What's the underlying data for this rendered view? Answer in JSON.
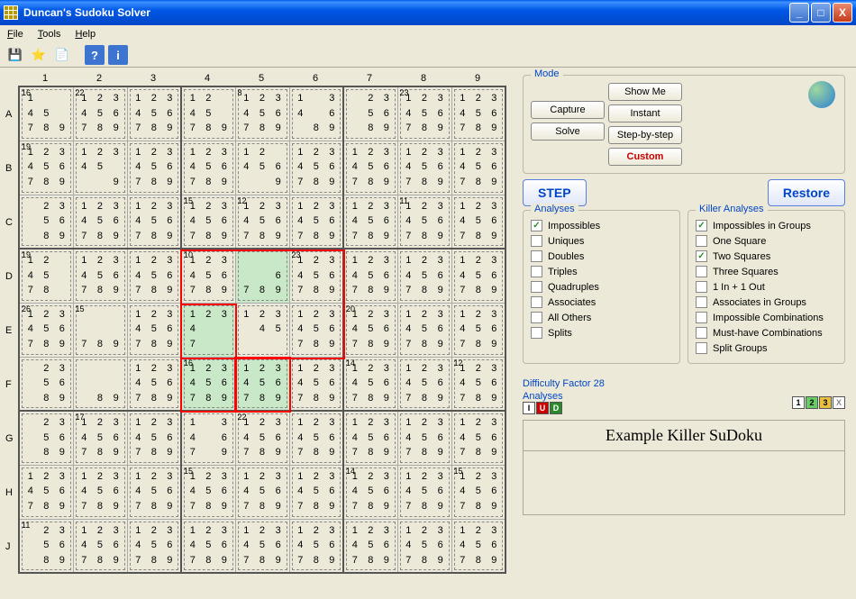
{
  "window": {
    "title": "Duncan's Sudoku Solver"
  },
  "menu": {
    "file": "File",
    "tools": "Tools",
    "help": "Help"
  },
  "toolbar": {
    "save": "💾",
    "star": "⭐",
    "page": "📄",
    "q": "?",
    "i": "i"
  },
  "cols": [
    "1",
    "2",
    "3",
    "4",
    "5",
    "6",
    "7",
    "8",
    "9"
  ],
  "rows": [
    "A",
    "B",
    "C",
    "D",
    "E",
    "F",
    "G",
    "H",
    "J"
  ],
  "cages": {
    "A1": "16",
    "A2": "22",
    "A5": "8",
    "A8": "23",
    "B1": "19",
    "C4": "15",
    "C5": "12",
    "C8": "11",
    "D1": "19",
    "D4": "10",
    "D6": "23",
    "E1": "26",
    "E2": "15",
    "E7": "20",
    "F4": "16",
    "F7": "14",
    "F9": "12",
    "G2": "17",
    "G5": "22",
    "H4": "15",
    "H7": "14",
    "H9": "15",
    "J1": "11"
  },
  "highlight": [
    "D5",
    "E4",
    "F4",
    "F5"
  ],
  "pencil_d5": [
    "",
    "",
    "",
    "",
    "",
    "6",
    "7",
    "8",
    "9"
  ],
  "pencil_f4": [
    "1",
    "2",
    "3",
    "4",
    "5",
    "6",
    "7",
    "8",
    "9"
  ],
  "pencil_alt": {
    "A1": [
      "1",
      "",
      "",
      "4",
      "5",
      "",
      "7",
      "8",
      "9"
    ],
    "A4": [
      "1",
      "2",
      "",
      "4",
      "5",
      "",
      "7",
      "8",
      "9"
    ],
    "A6": [
      "1",
      "",
      "3",
      "4",
      "",
      "6",
      "",
      "8",
      "9"
    ],
    "A7": [
      "",
      "2",
      "3",
      "",
      "5",
      "6",
      "",
      "8",
      "9"
    ],
    "B2": [
      "1",
      "2",
      "3",
      "4",
      "5",
      "",
      "",
      "",
      "9"
    ],
    "B5": [
      "1",
      "2",
      "",
      "4",
      "5",
      "6",
      "",
      "",
      "9"
    ],
    "C1": [
      "",
      "2",
      "3",
      "",
      "5",
      "6",
      "",
      "8",
      "9"
    ],
    "D1": [
      "1",
      "2",
      "",
      "4",
      "5",
      "",
      "7",
      "8",
      ""
    ],
    "E2": [
      "",
      "",
      "",
      "",
      "",
      "",
      "7",
      "8",
      "9"
    ],
    "E4": [
      "1",
      "2",
      "3",
      "4",
      "",
      "",
      "7",
      "",
      ""
    ],
    "E5": [
      "1",
      "2",
      "3",
      "",
      "4",
      "5",
      "",
      "",
      ""
    ],
    "F1": [
      "",
      "2",
      "3",
      "",
      "5",
      "6",
      "",
      "8",
      "9"
    ],
    "F2": [
      "",
      "",
      "",
      "",
      "",
      "",
      "",
      "8",
      "9"
    ],
    "G1": [
      "",
      "2",
      "3",
      "",
      "5",
      "6",
      "",
      "8",
      "9"
    ],
    "G4": [
      "1",
      "",
      "3",
      "4",
      "",
      "6",
      "7",
      "",
      "9"
    ],
    "J1": [
      "",
      "2",
      "3",
      "",
      "5",
      "6",
      "",
      "8",
      "9"
    ]
  },
  "mode": {
    "legend": "Mode",
    "capture": "Capture",
    "solve": "Solve",
    "showme": "Show Me",
    "instant": "Instant",
    "stepbystep": "Step-by-step",
    "custom": "Custom"
  },
  "step": "STEP",
  "restore": "Restore",
  "analyses": {
    "title": "Analyses",
    "items": [
      {
        "label": "Impossibles",
        "checked": true
      },
      {
        "label": "Uniques",
        "checked": false
      },
      {
        "label": "Doubles",
        "checked": false
      },
      {
        "label": "Triples",
        "checked": false
      },
      {
        "label": "Quadruples",
        "checked": false
      },
      {
        "label": "Associates",
        "checked": false
      },
      {
        "label": "All Others",
        "checked": false
      },
      {
        "label": "Splits",
        "checked": false
      }
    ]
  },
  "killer": {
    "title": "Killer Analyses",
    "items": [
      {
        "label": "Impossibles in Groups",
        "checked": true
      },
      {
        "label": "One Square",
        "checked": false
      },
      {
        "label": "Two Squares",
        "checked": true
      },
      {
        "label": "Three Squares",
        "checked": false
      },
      {
        "label": "1 In + 1 Out",
        "checked": false
      },
      {
        "label": "Associates in Groups",
        "checked": false
      },
      {
        "label": "Impossible Combinations",
        "checked": false
      },
      {
        "label": "Must-have Combinations",
        "checked": false
      },
      {
        "label": "Split Groups",
        "checked": false
      }
    ]
  },
  "difficulty": "Difficulty Factor 28",
  "analyses_label": "Analyses",
  "badges_left": [
    {
      "t": "I",
      "bg": "#fff",
      "c": "#000"
    },
    {
      "t": "U",
      "bg": "#c00",
      "c": "#fff"
    },
    {
      "t": "D",
      "bg": "#2a8a2a",
      "c": "#fff"
    }
  ],
  "badges_right": [
    {
      "t": "1",
      "bg": "#fff",
      "c": "#000"
    },
    {
      "t": "2",
      "bg": "#6c6",
      "c": "#000"
    },
    {
      "t": "3",
      "bg": "#e8c040",
      "c": "#000"
    },
    {
      "t": "X",
      "bg": "#fff",
      "c": "#888"
    }
  ],
  "status_title": "Example Killer SuDoku"
}
